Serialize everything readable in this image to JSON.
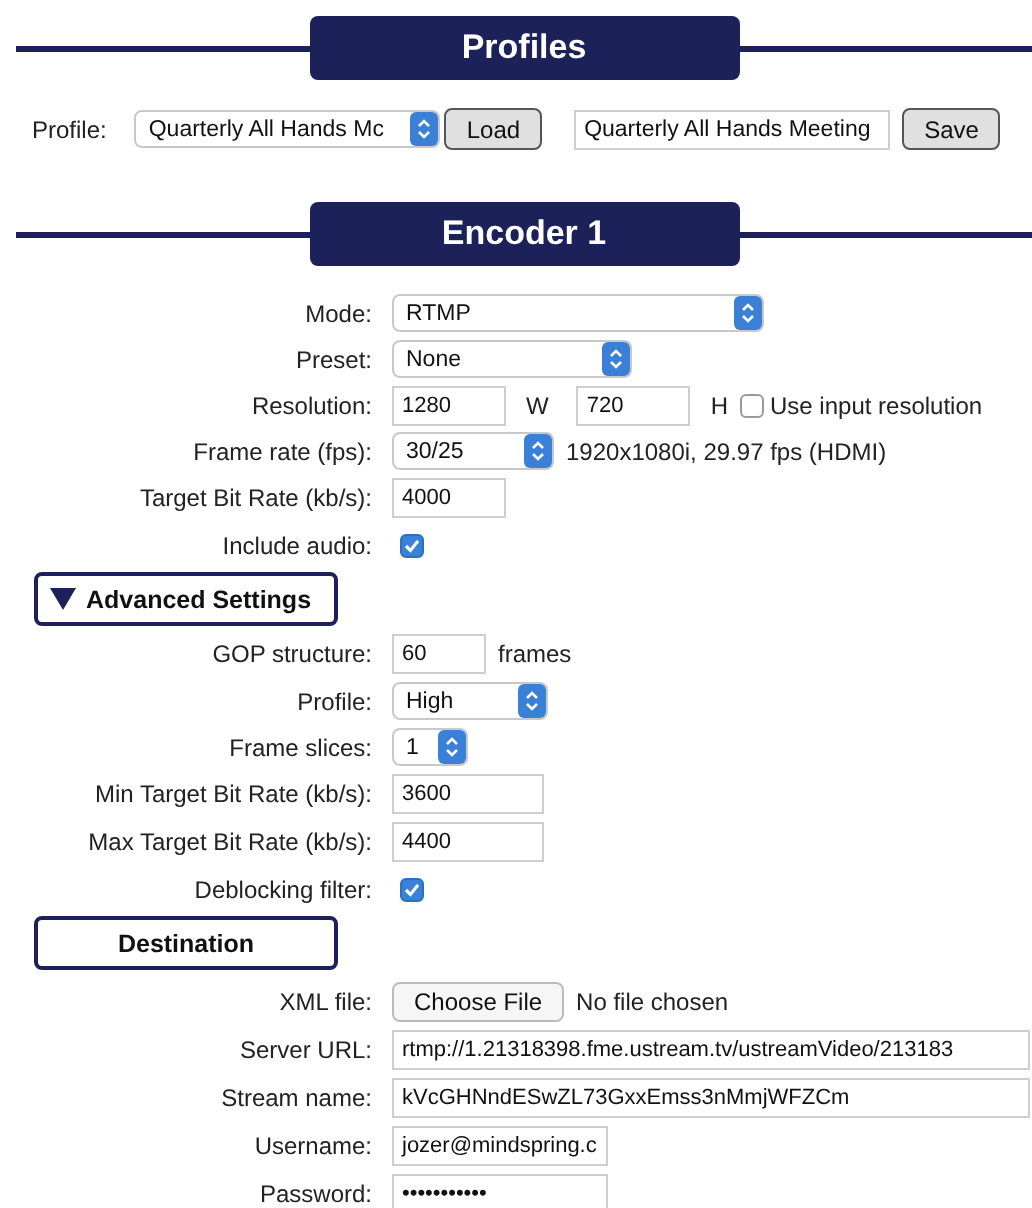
{
  "profiles": {
    "title": "Profiles",
    "label": "Profile:",
    "select_value": "Quarterly All Hands Mc",
    "load_button": "Load",
    "name_value": "Quarterly All Hands Meeting",
    "save_button": "Save"
  },
  "encoder": {
    "title": "Encoder 1",
    "fields": [
      {
        "kind": "select",
        "label": "Mode:",
        "value": "RTMP"
      },
      {
        "kind": "select",
        "label": "Preset:",
        "value": "None"
      },
      {
        "kind": "resolution",
        "label": "Resolution:",
        "width_value": "1280",
        "width_unit": "W",
        "height_value": "720",
        "height_unit": "H",
        "option_label": "Use input resolution",
        "checked": false
      },
      {
        "kind": "select",
        "label": "Frame rate (fps):",
        "value": "30/25",
        "note": "1920x1080i, 29.97 fps (HDMI)"
      },
      {
        "kind": "text",
        "label": "Target Bit Rate (kb/s):",
        "value": "4000"
      },
      {
        "kind": "checkbox",
        "label": "Include audio:",
        "checked": true
      }
    ]
  },
  "advanced": {
    "title": "Advanced Settings",
    "expanded": true,
    "fields": [
      {
        "kind": "text",
        "label": "GOP structure:",
        "value": "60",
        "note": "frames"
      },
      {
        "kind": "select",
        "label": "Profile:",
        "value": "High"
      },
      {
        "kind": "select",
        "label": "Frame slices:",
        "value": "1"
      },
      {
        "kind": "text",
        "label": "Min Target Bit Rate (kb/s):",
        "value": "3600"
      },
      {
        "kind": "text",
        "label": "Max Target Bit Rate (kb/s):",
        "value": "4400"
      },
      {
        "kind": "checkbox",
        "label": "Deblocking filter:",
        "checked": true
      }
    ]
  },
  "destination": {
    "title": "Destination",
    "fields": [
      {
        "kind": "file",
        "label": "XML file:",
        "button": "Choose File",
        "note": "No file chosen"
      },
      {
        "kind": "text",
        "label": "Server URL:",
        "value": "rtmp://1.21318398.fme.ustream.tv/ustreamVideo/213183"
      },
      {
        "kind": "text",
        "label": "Stream name:",
        "value": "kVcGHNndESwZL73GxxEmss3nMmjWFZCm"
      },
      {
        "kind": "text",
        "label": "Username:",
        "value": "jozer@mindspring.c"
      },
      {
        "kind": "password",
        "label": "Password:",
        "value": "•••••••••••"
      }
    ]
  }
}
